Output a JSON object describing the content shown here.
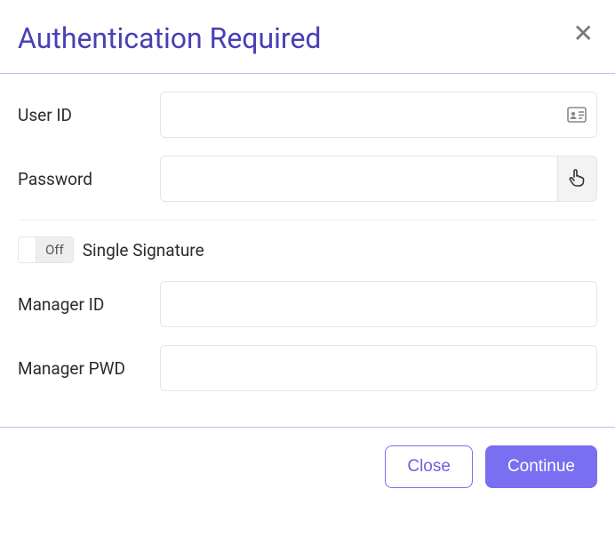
{
  "header": {
    "title": "Authentication Required"
  },
  "form": {
    "user_id_label": "User ID",
    "user_id_value": "",
    "password_label": "Password",
    "password_value": "",
    "single_signature_toggle_state": "Off",
    "single_signature_label": "Single Signature",
    "manager_id_label": "Manager ID",
    "manager_id_value": "",
    "manager_pwd_label": "Manager PWD",
    "manager_pwd_value": ""
  },
  "footer": {
    "close_label": "Close",
    "continue_label": "Continue"
  }
}
